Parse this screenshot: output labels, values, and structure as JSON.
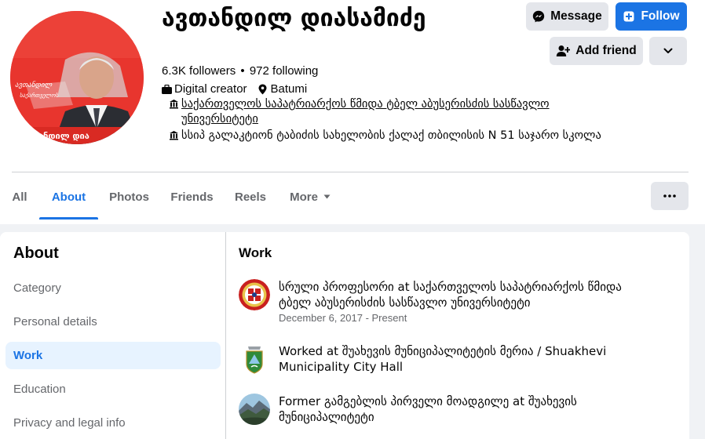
{
  "profile": {
    "name": "ავთანდილ დიასამიძე",
    "followers": "6.3K followers",
    "separator": "•",
    "following": "972 following",
    "category": "Digital creator",
    "location": "Batumi",
    "education": [
      "საქართველოს საპატრიარქოს წმიდა ტბელ აბუსერისძის სასწავლო უნივერსიტეტი",
      "სსიპ გალაკტიონ ტაბიძის სახელობის ქალაქ თბილისის N 51 საჯარო სკოლა"
    ],
    "avatar_text": {
      "line1": "ავთანდილ",
      "line2": "საქართველოს",
      "bottom": "ანდილ დია"
    }
  },
  "actions": {
    "message": "Message",
    "follow": "Follow",
    "add_friend": "Add friend"
  },
  "tabs": [
    "All",
    "About",
    "Photos",
    "Friends",
    "Reels",
    "More"
  ],
  "active_tab": "About",
  "sidebar": {
    "title": "About",
    "items": [
      "Category",
      "Personal details",
      "Work",
      "Education",
      "Privacy and legal info"
    ],
    "active": "Work"
  },
  "work": {
    "title": "Work",
    "items": [
      {
        "title": "სრული პროფესორი at საქართველოს საპატრიარქოს წმიდა ტბელ აბუსერისძის სასწავლო უნივერსიტეტი",
        "date": "December 6, 2017 - Present"
      },
      {
        "title": "Worked at შუახევის მუნიციპალიტეტის მერია / Shuakhevi Municipality City Hall"
      },
      {
        "title": "Former გამგებლის პირველი მოადგილე at შუახევის მუნიციპალიტეტი"
      }
    ]
  },
  "colors": {
    "accent": "#1b74e4",
    "accent_bg": "#e7f3ff",
    "button_gray": "#e4e6eb",
    "secondary_text": "#65676b",
    "page_bg": "#f0f2f5"
  },
  "icons": {
    "message": "messenger-icon",
    "follow": "follow-icon",
    "add_friend": "add-friend-icon",
    "dropdown": "chevron-down-icon",
    "category": "briefcase-icon",
    "location": "location-pin-icon",
    "education": "school-icon",
    "more_options": "more-dots-icon"
  }
}
